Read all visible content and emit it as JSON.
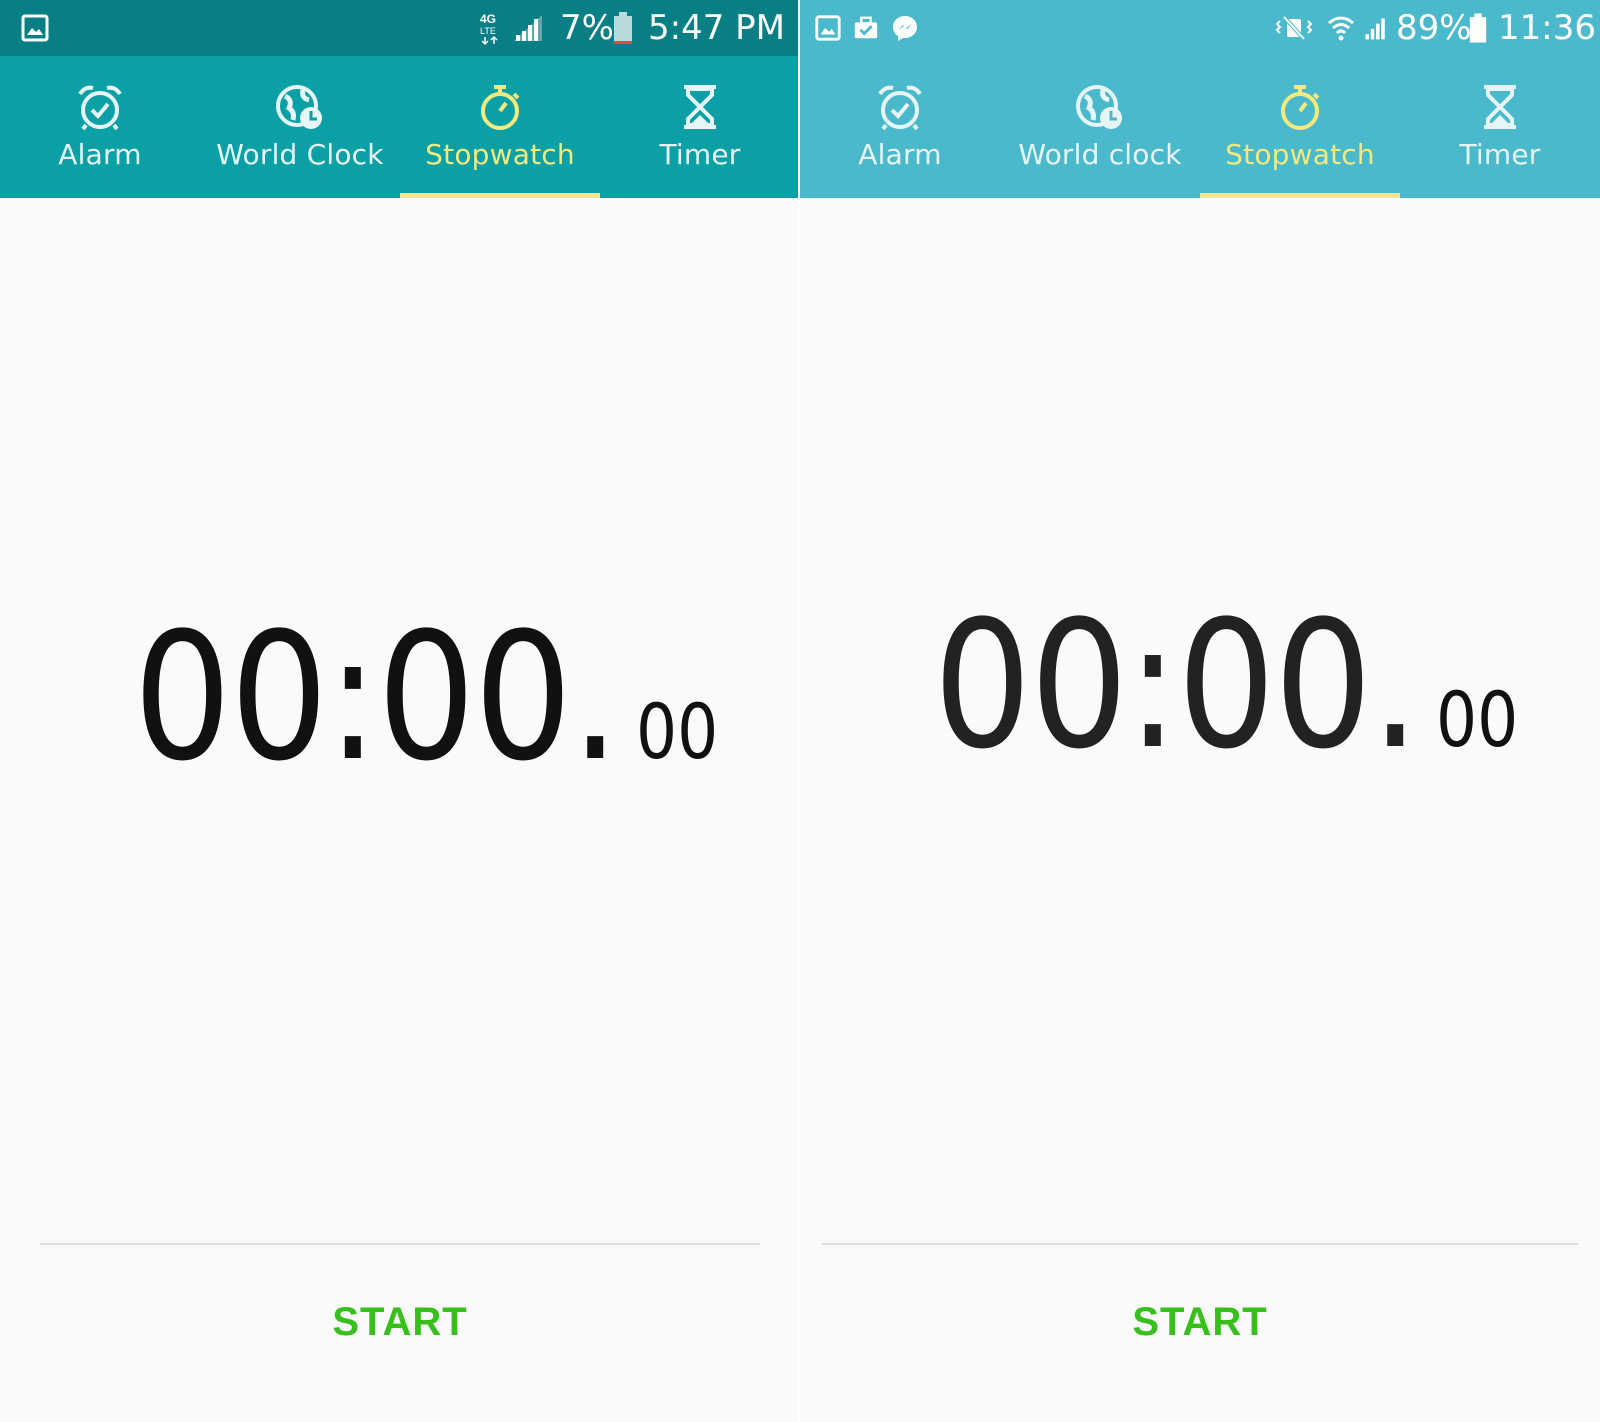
{
  "left_phone": {
    "status": {
      "network_label": "4G LTE",
      "battery_percent": "7%",
      "clock": "5:47 PM",
      "icons": [
        "gallery-notification-icon",
        "4g-lte-icon",
        "signal-icon",
        "battery-low-icon"
      ]
    },
    "tabs": [
      {
        "label": "Alarm",
        "icon": "alarm-clock-icon"
      },
      {
        "label": "World Clock",
        "icon": "globe-clock-icon"
      },
      {
        "label": "Stopwatch",
        "icon": "stopwatch-icon",
        "active": true
      },
      {
        "label": "Timer",
        "icon": "hourglass-icon"
      }
    ],
    "stopwatch": {
      "main": "00:00.",
      "fraction": "00"
    },
    "start_label": "START"
  },
  "right_phone": {
    "status": {
      "battery_percent": "89%",
      "clock": "11:36",
      "icons": [
        "gallery-notification-icon",
        "briefcase-check-icon",
        "messenger-icon",
        "vibrate-mute-icon",
        "wifi-icon",
        "signal-icon",
        "battery-icon"
      ]
    },
    "tabs": [
      {
        "label": "Alarm",
        "icon": "alarm-clock-icon"
      },
      {
        "label": "World clock",
        "icon": "globe-clock-icon"
      },
      {
        "label": "Stopwatch",
        "icon": "stopwatch-icon",
        "active": true
      },
      {
        "label": "Timer",
        "icon": "hourglass-icon"
      }
    ],
    "stopwatch": {
      "main": "00:00.",
      "fraction": "00"
    },
    "start_label": "START"
  },
  "colors": {
    "left_status_bar": "#087f84",
    "left_tab_bar": "#0aa0a6",
    "right_bar": "#4ab9cc",
    "active_tab": "#f3e97c",
    "start_green": "#37c01b",
    "background": "#fafafa"
  }
}
